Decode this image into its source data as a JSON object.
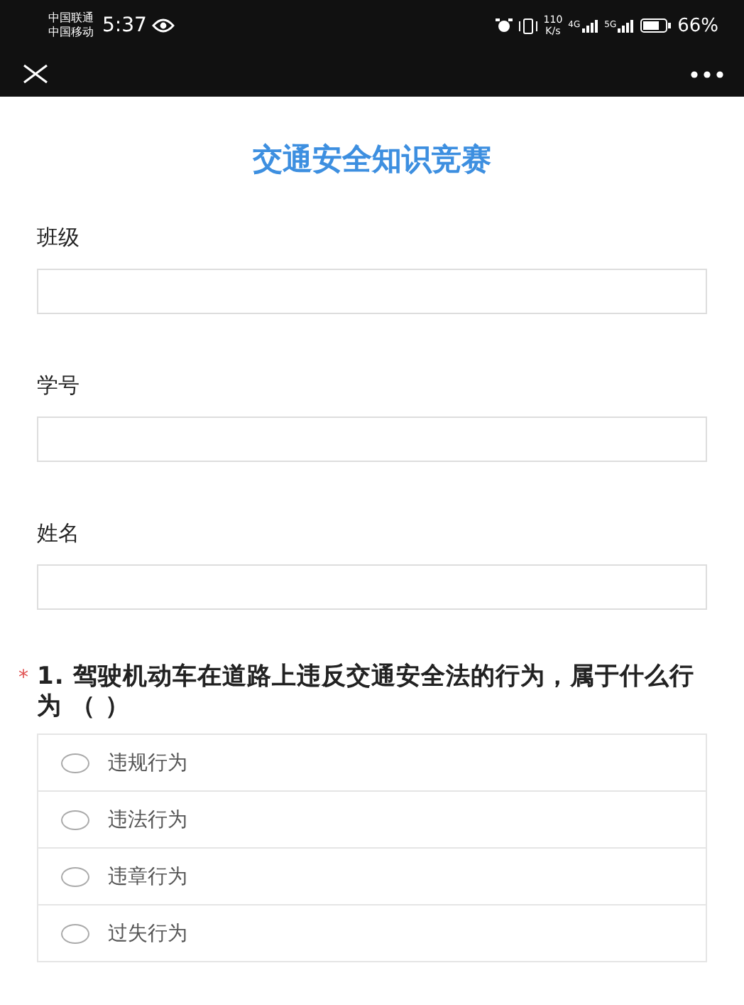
{
  "status_bar": {
    "carriers": [
      "中国联通",
      "中国移动"
    ],
    "time": "5:37",
    "speed_value": "110",
    "speed_unit": "K/s",
    "networks": [
      "4G",
      "5G"
    ],
    "battery": "66%"
  },
  "title": "交通安全知识竞赛",
  "fields": [
    {
      "label": "班级"
    },
    {
      "label": "学号"
    },
    {
      "label": "姓名"
    }
  ],
  "questions": [
    {
      "required": true,
      "required_mark": "*",
      "text": "1. 驾驶机动车在道路上违反交通安全法的行为，属于什么行为 （ ）",
      "options": [
        {
          "label": "违规行为",
          "selected": false
        },
        {
          "label": "违法行为",
          "selected": false
        },
        {
          "label": "违章行为",
          "selected": false
        },
        {
          "label": "过失行为",
          "selected": false
        }
      ]
    }
  ]
}
